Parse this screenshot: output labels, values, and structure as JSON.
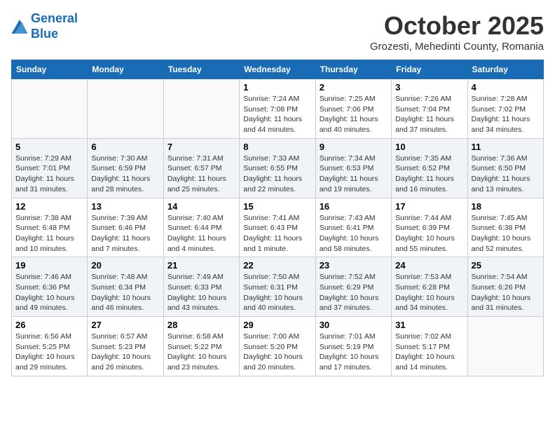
{
  "logo": {
    "line1": "General",
    "line2": "Blue"
  },
  "title": "October 2025",
  "location": "Grozesti, Mehedinti County, Romania",
  "weekdays": [
    "Sunday",
    "Monday",
    "Tuesday",
    "Wednesday",
    "Thursday",
    "Friday",
    "Saturday"
  ],
  "weeks": [
    [
      {
        "day": "",
        "info": ""
      },
      {
        "day": "",
        "info": ""
      },
      {
        "day": "",
        "info": ""
      },
      {
        "day": "1",
        "info": "Sunrise: 7:24 AM\nSunset: 7:08 PM\nDaylight: 11 hours\nand 44 minutes."
      },
      {
        "day": "2",
        "info": "Sunrise: 7:25 AM\nSunset: 7:06 PM\nDaylight: 11 hours\nand 40 minutes."
      },
      {
        "day": "3",
        "info": "Sunrise: 7:26 AM\nSunset: 7:04 PM\nDaylight: 11 hours\nand 37 minutes."
      },
      {
        "day": "4",
        "info": "Sunrise: 7:28 AM\nSunset: 7:02 PM\nDaylight: 11 hours\nand 34 minutes."
      }
    ],
    [
      {
        "day": "5",
        "info": "Sunrise: 7:29 AM\nSunset: 7:01 PM\nDaylight: 11 hours\nand 31 minutes."
      },
      {
        "day": "6",
        "info": "Sunrise: 7:30 AM\nSunset: 6:59 PM\nDaylight: 11 hours\nand 28 minutes."
      },
      {
        "day": "7",
        "info": "Sunrise: 7:31 AM\nSunset: 6:57 PM\nDaylight: 11 hours\nand 25 minutes."
      },
      {
        "day": "8",
        "info": "Sunrise: 7:33 AM\nSunset: 6:55 PM\nDaylight: 11 hours\nand 22 minutes."
      },
      {
        "day": "9",
        "info": "Sunrise: 7:34 AM\nSunset: 6:53 PM\nDaylight: 11 hours\nand 19 minutes."
      },
      {
        "day": "10",
        "info": "Sunrise: 7:35 AM\nSunset: 6:52 PM\nDaylight: 11 hours\nand 16 minutes."
      },
      {
        "day": "11",
        "info": "Sunrise: 7:36 AM\nSunset: 6:50 PM\nDaylight: 11 hours\nand 13 minutes."
      }
    ],
    [
      {
        "day": "12",
        "info": "Sunrise: 7:38 AM\nSunset: 6:48 PM\nDaylight: 11 hours\nand 10 minutes."
      },
      {
        "day": "13",
        "info": "Sunrise: 7:39 AM\nSunset: 6:46 PM\nDaylight: 11 hours\nand 7 minutes."
      },
      {
        "day": "14",
        "info": "Sunrise: 7:40 AM\nSunset: 6:44 PM\nDaylight: 11 hours\nand 4 minutes."
      },
      {
        "day": "15",
        "info": "Sunrise: 7:41 AM\nSunset: 6:43 PM\nDaylight: 11 hours\nand 1 minute."
      },
      {
        "day": "16",
        "info": "Sunrise: 7:43 AM\nSunset: 6:41 PM\nDaylight: 10 hours\nand 58 minutes."
      },
      {
        "day": "17",
        "info": "Sunrise: 7:44 AM\nSunset: 6:39 PM\nDaylight: 10 hours\nand 55 minutes."
      },
      {
        "day": "18",
        "info": "Sunrise: 7:45 AM\nSunset: 6:38 PM\nDaylight: 10 hours\nand 52 minutes."
      }
    ],
    [
      {
        "day": "19",
        "info": "Sunrise: 7:46 AM\nSunset: 6:36 PM\nDaylight: 10 hours\nand 49 minutes."
      },
      {
        "day": "20",
        "info": "Sunrise: 7:48 AM\nSunset: 6:34 PM\nDaylight: 10 hours\nand 46 minutes."
      },
      {
        "day": "21",
        "info": "Sunrise: 7:49 AM\nSunset: 6:33 PM\nDaylight: 10 hours\nand 43 minutes."
      },
      {
        "day": "22",
        "info": "Sunrise: 7:50 AM\nSunset: 6:31 PM\nDaylight: 10 hours\nand 40 minutes."
      },
      {
        "day": "23",
        "info": "Sunrise: 7:52 AM\nSunset: 6:29 PM\nDaylight: 10 hours\nand 37 minutes."
      },
      {
        "day": "24",
        "info": "Sunrise: 7:53 AM\nSunset: 6:28 PM\nDaylight: 10 hours\nand 34 minutes."
      },
      {
        "day": "25",
        "info": "Sunrise: 7:54 AM\nSunset: 6:26 PM\nDaylight: 10 hours\nand 31 minutes."
      }
    ],
    [
      {
        "day": "26",
        "info": "Sunrise: 6:56 AM\nSunset: 5:25 PM\nDaylight: 10 hours\nand 29 minutes."
      },
      {
        "day": "27",
        "info": "Sunrise: 6:57 AM\nSunset: 5:23 PM\nDaylight: 10 hours\nand 26 minutes."
      },
      {
        "day": "28",
        "info": "Sunrise: 6:58 AM\nSunset: 5:22 PM\nDaylight: 10 hours\nand 23 minutes."
      },
      {
        "day": "29",
        "info": "Sunrise: 7:00 AM\nSunset: 5:20 PM\nDaylight: 10 hours\nand 20 minutes."
      },
      {
        "day": "30",
        "info": "Sunrise: 7:01 AM\nSunset: 5:19 PM\nDaylight: 10 hours\nand 17 minutes."
      },
      {
        "day": "31",
        "info": "Sunrise: 7:02 AM\nSunset: 5:17 PM\nDaylight: 10 hours\nand 14 minutes."
      },
      {
        "day": "",
        "info": ""
      }
    ]
  ]
}
